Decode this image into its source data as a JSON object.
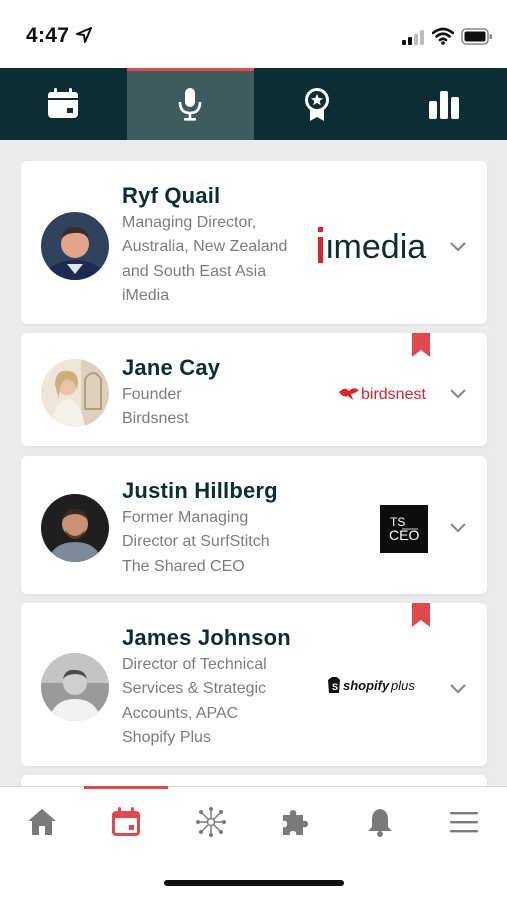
{
  "status": {
    "time": "4:47"
  },
  "top_tabs": [
    {
      "icon": "calendar-icon",
      "active": false
    },
    {
      "icon": "microphone-icon",
      "active": true
    },
    {
      "icon": "award-icon",
      "active": false
    },
    {
      "icon": "bar-chart-icon",
      "active": false
    }
  ],
  "speakers": [
    {
      "name": "Ryf Quail",
      "role_lines": [
        "Managing Director,",
        "Australia, New Zealand",
        "and South East Asia",
        "iMedia"
      ],
      "logo_text": "imedia",
      "bookmarked": false
    },
    {
      "name": "Jane Cay",
      "role_lines": [
        "Founder",
        "Birdsnest"
      ],
      "logo_text": "birdsnest",
      "bookmarked": true
    },
    {
      "name": "Justin Hillberg",
      "role_lines": [
        "Former Managing",
        "Director at SurfStitch",
        "The Shared CEO"
      ],
      "logo_text_1": "TS",
      "logo_text_2": "CEO",
      "bookmarked": false
    },
    {
      "name": "James Johnson",
      "role_lines": [
        "Director of Technical",
        "Services & Strategic",
        "Accounts, APAC",
        "Shopify Plus"
      ],
      "logo_text": "shopify",
      "logo_text_2": "plus",
      "bookmarked": true
    }
  ],
  "bottom_nav": [
    {
      "icon": "home-icon",
      "active": false
    },
    {
      "icon": "calendar-icon",
      "active": true
    },
    {
      "icon": "network-icon",
      "active": false
    },
    {
      "icon": "puzzle-icon",
      "active": false
    },
    {
      "icon": "bell-icon",
      "active": false
    },
    {
      "icon": "menu-icon",
      "active": false
    }
  ],
  "colors": {
    "accent": "#e04a4f",
    "nav_bg": "#0b2d33",
    "nav_active": "#3e5b60",
    "name_text": "#0b2d33",
    "muted_text": "#7c7c7c",
    "bottom_icon": "#7a7a7a"
  }
}
